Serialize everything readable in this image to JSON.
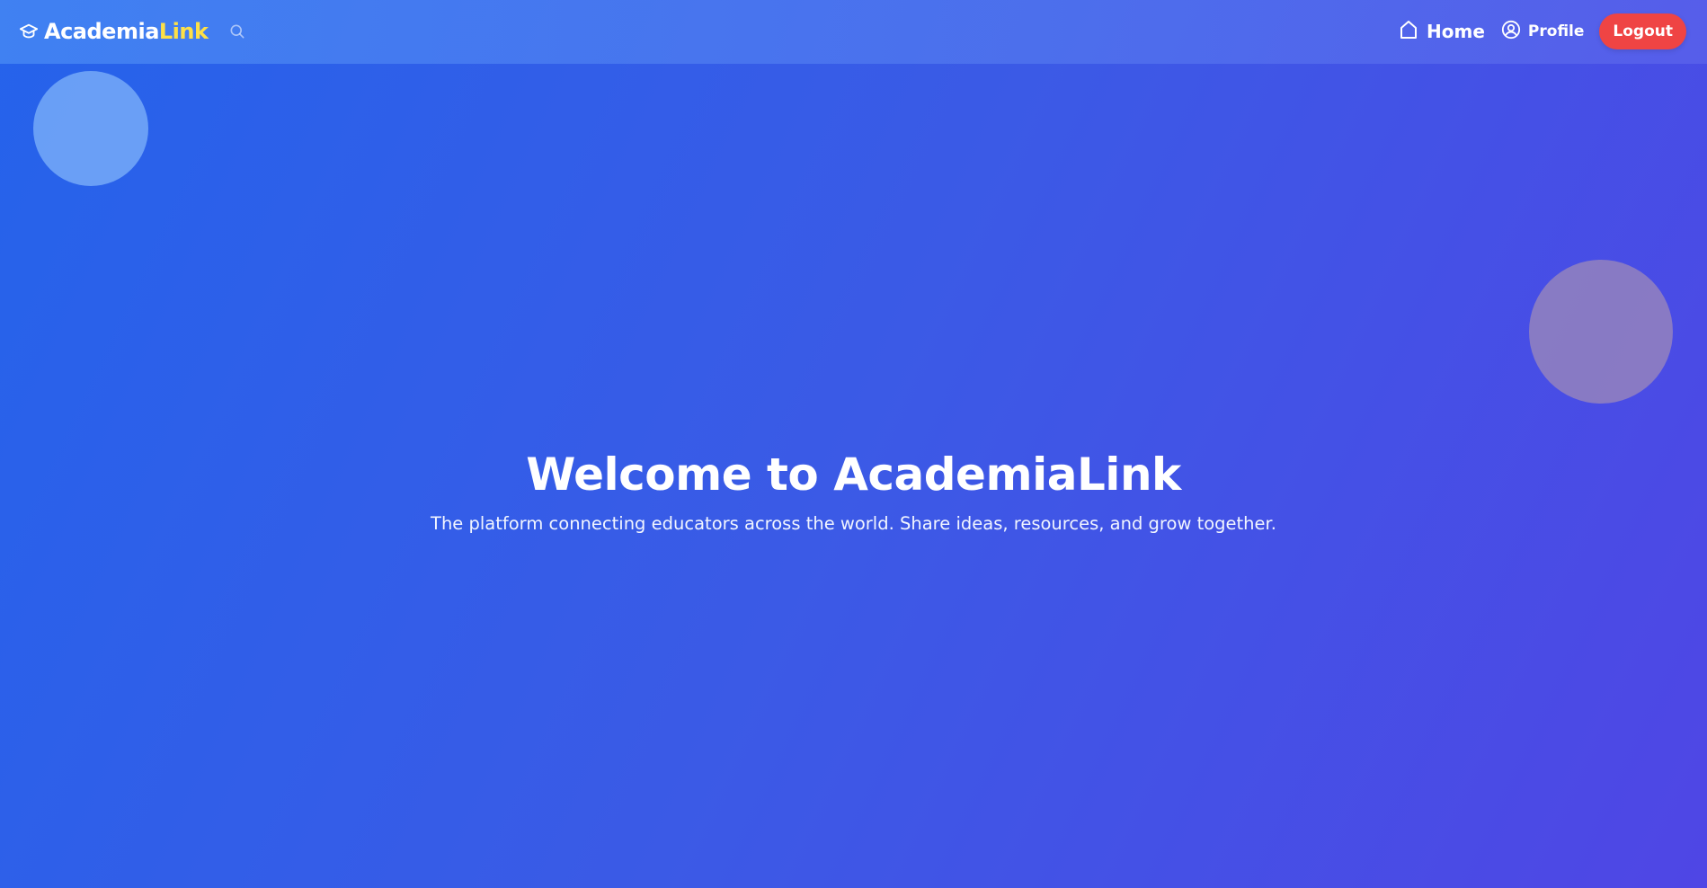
{
  "navbar": {
    "brand": {
      "icon": "graduation-cap-icon",
      "name_primary": "Academia",
      "name_accent": "Link",
      "accent_color": "#fde047"
    },
    "search_icon": "search-icon",
    "links": {
      "home": {
        "icon": "home-icon",
        "label": "Home"
      },
      "profile": {
        "icon": "user-circle-icon",
        "label": "Profile"
      }
    },
    "logout": {
      "label": "Logout",
      "color": "#ef4444"
    }
  },
  "hero": {
    "title": "Welcome to AcademiaLink",
    "subtitle": "The platform connecting educators across the world. Share ideas, resources, and grow together."
  },
  "theme": {
    "background_start": "#2563eb",
    "background_end": "#4f46e5",
    "text_color": "#ffffff"
  }
}
